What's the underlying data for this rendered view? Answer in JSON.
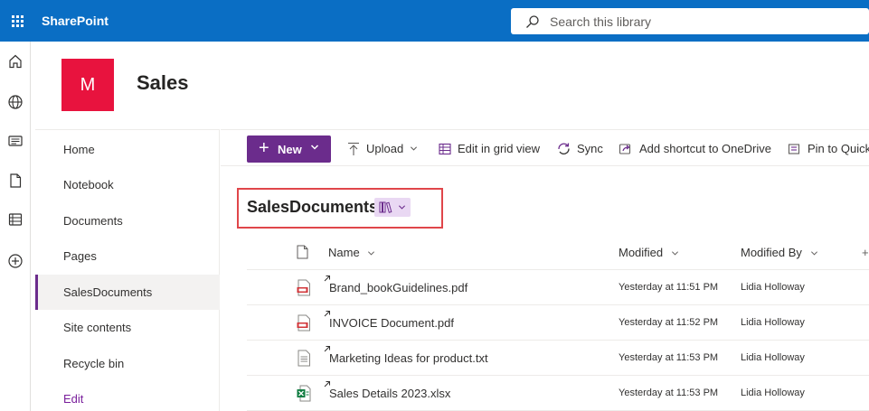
{
  "suite": {
    "app_name": "SharePoint",
    "search_placeholder": "Search this library"
  },
  "site": {
    "logo_letter": "M",
    "title": "Sales"
  },
  "nav": {
    "items": [
      {
        "label": "Home"
      },
      {
        "label": "Notebook"
      },
      {
        "label": "Documents"
      },
      {
        "label": "Pages"
      },
      {
        "label": "SalesDocuments",
        "selected": true
      },
      {
        "label": "Site contents"
      },
      {
        "label": "Recycle bin"
      }
    ],
    "edit_label": "Edit"
  },
  "command_bar": {
    "new_label": "New",
    "upload_label": "Upload",
    "grid_label": "Edit in grid view",
    "sync_label": "Sync",
    "shortcut_label": "Add shortcut to OneDrive",
    "pin_label": "Pin to Quick"
  },
  "library": {
    "title": "SalesDocuments"
  },
  "columns": {
    "name": "Name",
    "modified": "Modified",
    "modified_by": "Modified By",
    "add": "+"
  },
  "files": [
    {
      "name": "Brand_bookGuidelines.pdf",
      "modified": "Yesterday at 11:51 PM",
      "modified_by": "Lidia Holloway",
      "icon": "pdf-file-icon"
    },
    {
      "name": "INVOICE Document.pdf",
      "modified": "Yesterday at 11:52 PM",
      "modified_by": "Lidia Holloway",
      "icon": "pdf-file-icon"
    },
    {
      "name": "Marketing Ideas for product.txt",
      "modified": "Yesterday at 11:53 PM",
      "modified_by": "Lidia Holloway",
      "icon": "text-file-icon"
    },
    {
      "name": "Sales Details 2023.xlsx",
      "modified": "Yesterday at 11:53 PM",
      "modified_by": "Lidia Holloway",
      "icon": "excel-file-icon"
    }
  ],
  "colors": {
    "suite_bar": "#0a6ec4",
    "accent": "#6b2c8c",
    "site_logo": "#e8133e",
    "highlight_box": "#e0464a"
  }
}
